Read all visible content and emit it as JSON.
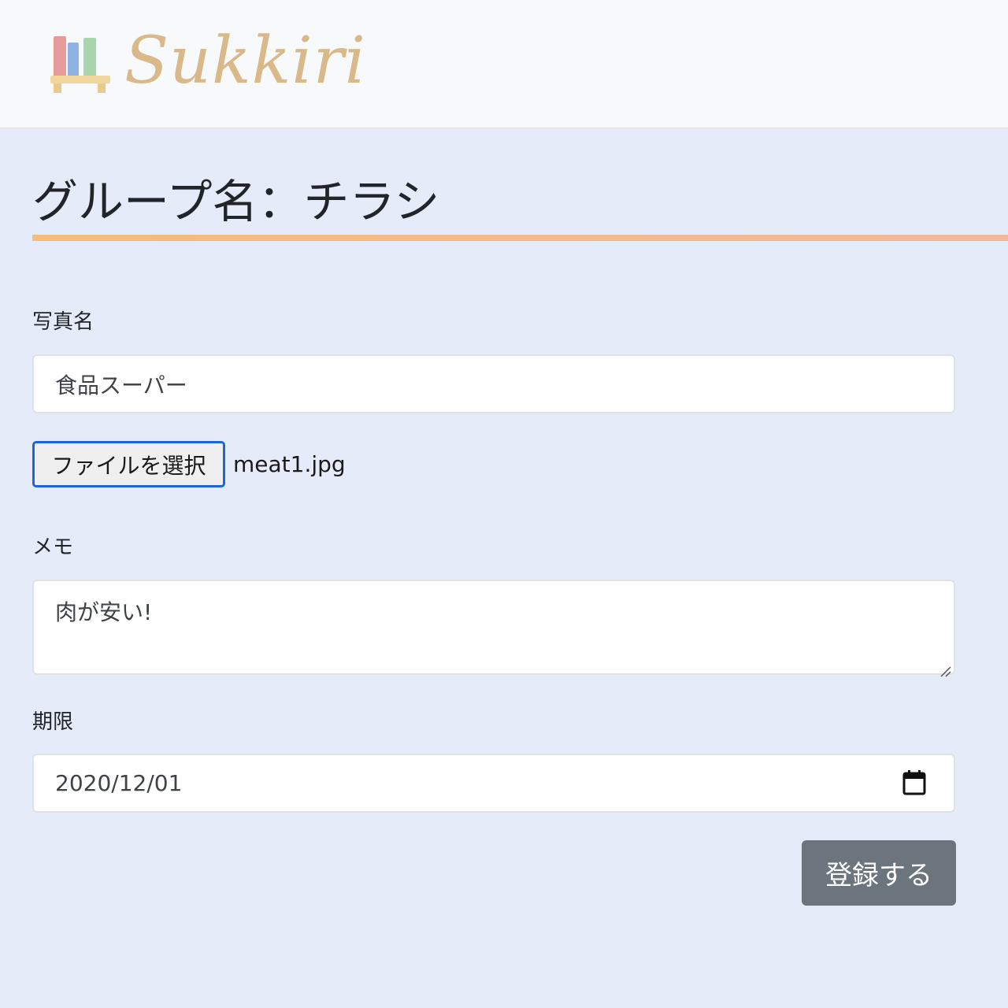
{
  "navbar": {
    "brand_name": "Sukkiri",
    "brand_icon": "bookshelf-icon"
  },
  "page": {
    "title": "グループ名：チラシ"
  },
  "form": {
    "photo_name_label": "写真名",
    "photo_name_value": "食品スーパー",
    "file_button_label": "ファイルを選択",
    "file_name": "meat1.jpg",
    "memo_label": "メモ",
    "memo_value": "肉が安い!",
    "deadline_label": "期限",
    "deadline_value": "2020/12/01",
    "calendar_icon": "calendar-icon",
    "submit_label": "登録する"
  },
  "colors": {
    "background": "#e6ebf9",
    "navbar_bg": "#f8f9fa",
    "brand_text": "#d9b98a",
    "accent_underline": "#f3bc79",
    "submit_button": "#6c757d",
    "file_button_border": "#1e66d6"
  }
}
